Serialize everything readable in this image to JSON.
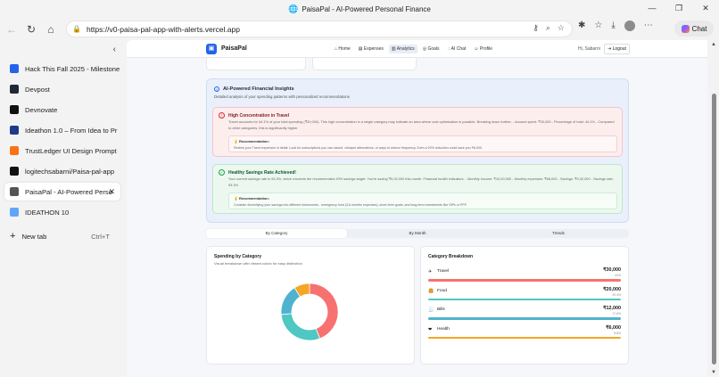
{
  "window": {
    "title": "PaisaPal - AI-Powered Personal Finance"
  },
  "browser": {
    "url": "https://v0-paisa-pal-app-with-alerts.vercel.app",
    "chat_label": "Chat"
  },
  "tabs": [
    {
      "label": "Hack This Fall 2025 - Milestone",
      "color": "#2563eb"
    },
    {
      "label": "Devpost",
      "color": "#1f2937"
    },
    {
      "label": "Devnovate",
      "color": "#111111"
    },
    {
      "label": "Ideathon 1.0 – From Idea to Pr",
      "color": "#1e3a8a"
    },
    {
      "label": "TrustLedger UI Design Prompt",
      "color": "#f97316"
    },
    {
      "label": "logitechsabarni/Paisa-pal-app",
      "color": "#111111"
    },
    {
      "label": "PaisaPal - AI-Powered Perso",
      "color": "#555555",
      "active": true
    },
    {
      "label": "IDEATHON 10",
      "color": "#60a5fa"
    }
  ],
  "new_tab": {
    "label": "New tab",
    "shortcut": "Ctrl+T"
  },
  "app": {
    "brand": "PaisaPal",
    "nav": [
      "Home",
      "Expenses",
      "Analytics",
      "Goals",
      "AI Chat",
      "Profile"
    ],
    "active_nav": "Analytics",
    "greeting": "Hi, Sabarni",
    "logout": "Logout"
  },
  "insights": {
    "title": "AI-Powered Financial Insights",
    "subtitle": "Detailed analysis of your spending patterns with personalized recommendations",
    "alerts": [
      {
        "kind": "warning",
        "heading": "High Concentration in Travel",
        "text": "Travel accounts for 44.1% of your total spending (₹30,000). This high concentration in a single category may indicate an area where cost optimization is possible. Breaking down further: - Amount spent: ₹30,000 - Percentage of total: 44.1% - Compared to other categories, this is significantly higher",
        "rec_label": "Recommendation:",
        "rec_text": "Review your Travel expenses in detail. Look for subscriptions you can cancel, cheaper alternatives, or ways to reduce frequency. Even a 20% reduction could save you ₹6,000."
      },
      {
        "kind": "success",
        "heading": "Healthy Savings Rate Achieved!",
        "text": "Your current savings rate is 93.3%, which exceeds the recommended 20% savings target. You're saving ₹9,32,000 this month. Financial health indicators: - Monthly income: ₹10,00,000 - Monthly expenses: ₹68,000 - Savings: ₹9,32,000 - Savings rate: 93.3%",
        "rec_label": "Recommendation:",
        "rec_text": "Consider diversifying your savings into different instruments - emergency fund (3-6 months expenses), short-term goals, and long-term investments like SIPs or PPF."
      }
    ]
  },
  "view_tabs": [
    "By Category",
    "By Month",
    "Trends"
  ],
  "spending": {
    "title": "Spending by Category",
    "subtitle": "Visual breakdown with vibrant colors for easy distinction"
  },
  "breakdown": {
    "title": "Category Breakdown",
    "items": [
      {
        "name": "Travel",
        "amount": "₹30,000",
        "pct": "44%",
        "share": 0.441,
        "color": "#f87171",
        "icon": "✈"
      },
      {
        "name": "Food",
        "amount": "₹20,000",
        "pct": "29.4%",
        "share": 0.294,
        "color": "#4fc7c2",
        "icon": "🍔"
      },
      {
        "name": "Bills",
        "amount": "₹12,000",
        "pct": "17.6%",
        "share": 0.176,
        "color": "#4fb3cf",
        "icon": "🧾"
      },
      {
        "name": "Health",
        "amount": "₹6,000",
        "pct": "8.8%",
        "share": 0.088,
        "color": "#f5a623",
        "icon": "❤"
      }
    ]
  },
  "chart_data": {
    "type": "pie",
    "title": "Spending by Category",
    "categories": [
      "Travel",
      "Food",
      "Bills",
      "Health"
    ],
    "values": [
      30000,
      20000,
      12000,
      6000
    ],
    "colors": [
      "#f87171",
      "#4fc7c2",
      "#4fb3cf",
      "#f5a623"
    ]
  }
}
